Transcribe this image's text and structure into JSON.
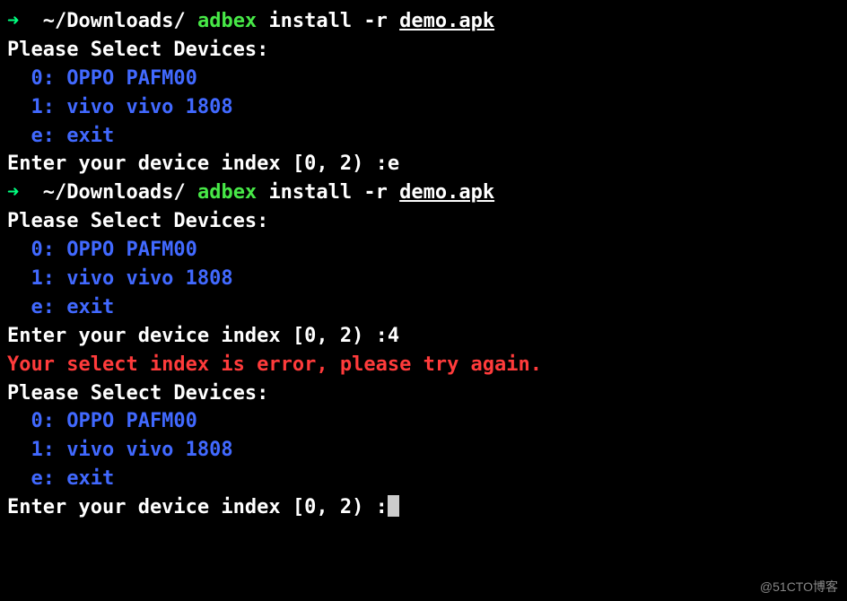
{
  "prompt1": {
    "arrow": "➜",
    "path": "~/Downloads/",
    "cmd": "adbex",
    "args": "install -r",
    "file": "demo.apk"
  },
  "block1": {
    "select_prompt": "Please Select Devices:",
    "device0": "  0: OPPO PAFM00",
    "device1": "  1: vivo vivo 1808",
    "exit": "  e: exit",
    "enter_prompt": "Enter your device index [0, 2) :",
    "input": "e"
  },
  "prompt2": {
    "arrow": "➜",
    "path": "~/Downloads/",
    "cmd": "adbex",
    "args": "install -r",
    "file": "demo.apk"
  },
  "block2": {
    "select_prompt": "Please Select Devices:",
    "device0": "  0: OPPO PAFM00",
    "device1": "  1: vivo vivo 1808",
    "exit": "  e: exit",
    "enter_prompt": "Enter your device index [0, 2) :",
    "input": "4"
  },
  "error_msg": "Your select index is error, please try again.",
  "block3": {
    "select_prompt": "Please Select Devices:",
    "device0": "  0: OPPO PAFM00",
    "device1": "  1: vivo vivo 1808",
    "exit": "  e: exit",
    "enter_prompt": "Enter your device index [0, 2) :"
  },
  "watermark": "@51CTO博客"
}
